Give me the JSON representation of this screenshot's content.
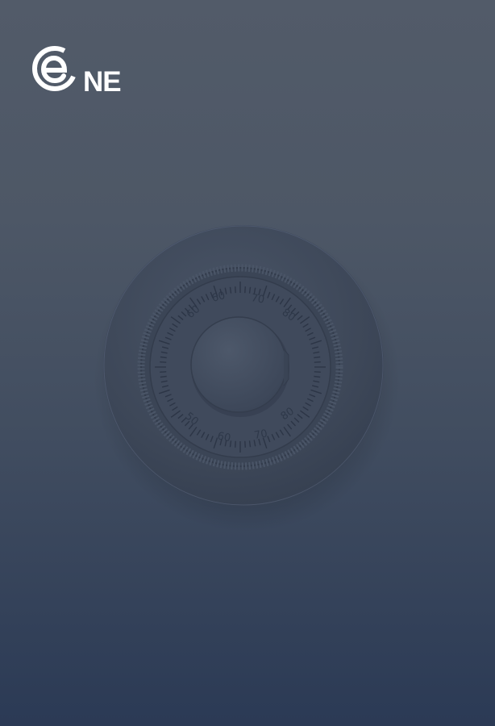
{
  "brand": {
    "logo_icon": "e-circle-logo-icon",
    "logo_text": "NE",
    "logo_color": "#ffffff"
  },
  "dial": {
    "icon": "combination-lock-dial-icon",
    "numbers_top": [
      "60",
      "60",
      "70",
      "80"
    ],
    "numbers_bottom": [
      "50",
      "60",
      "70",
      "80"
    ]
  },
  "colors": {
    "background_top": "#525b69",
    "background_bottom": "#2b3a55",
    "dial_body": "#3e4859"
  }
}
